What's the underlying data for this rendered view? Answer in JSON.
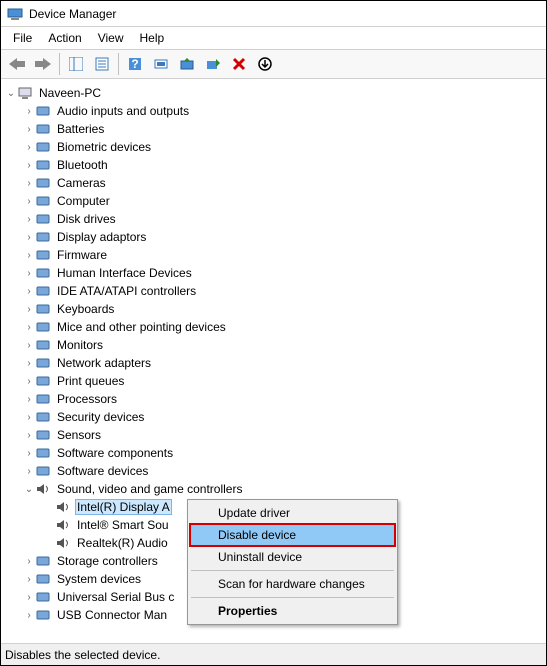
{
  "title": "Device Manager",
  "menus": [
    "File",
    "Action",
    "View",
    "Help"
  ],
  "root": "Naveen-PC",
  "categories": [
    {
      "label": "Audio inputs and outputs",
      "icon": "speaker"
    },
    {
      "label": "Batteries",
      "icon": "battery"
    },
    {
      "label": "Biometric devices",
      "icon": "fingerprint"
    },
    {
      "label": "Bluetooth",
      "icon": "bluetooth"
    },
    {
      "label": "Cameras",
      "icon": "camera"
    },
    {
      "label": "Computer",
      "icon": "computer"
    },
    {
      "label": "Disk drives",
      "icon": "disk"
    },
    {
      "label": "Display adaptors",
      "icon": "display"
    },
    {
      "label": "Firmware",
      "icon": "firmware"
    },
    {
      "label": "Human Interface Devices",
      "icon": "hid"
    },
    {
      "label": "IDE ATA/ATAPI controllers",
      "icon": "ide"
    },
    {
      "label": "Keyboards",
      "icon": "keyboard"
    },
    {
      "label": "Mice and other pointing devices",
      "icon": "mouse"
    },
    {
      "label": "Monitors",
      "icon": "monitor"
    },
    {
      "label": "Network adapters",
      "icon": "network"
    },
    {
      "label": "Print queues",
      "icon": "printer"
    },
    {
      "label": "Processors",
      "icon": "cpu"
    },
    {
      "label": "Security devices",
      "icon": "security"
    },
    {
      "label": "Sensors",
      "icon": "sensor"
    },
    {
      "label": "Software components",
      "icon": "sw"
    },
    {
      "label": "Software devices",
      "icon": "sw"
    }
  ],
  "expanded": {
    "label": "Sound, video and game controllers",
    "children": [
      {
        "label": "Intel(R) Display A",
        "selected": true
      },
      {
        "label": "Intel® Smart Sou"
      },
      {
        "label": "Realtek(R) Audio"
      }
    ]
  },
  "categories_after": [
    {
      "label": "Storage controllers",
      "icon": "storage"
    },
    {
      "label": "System devices",
      "icon": "system"
    },
    {
      "label": "Universal Serial Bus c",
      "icon": "usb"
    },
    {
      "label": "USB Connector Man",
      "icon": "usb"
    }
  ],
  "context_menu": [
    {
      "label": "Update driver"
    },
    {
      "label": "Disable device",
      "hl": true
    },
    {
      "label": "Uninstall device"
    },
    {
      "sep": true
    },
    {
      "label": "Scan for hardware changes"
    },
    {
      "sep": true
    },
    {
      "label": "Properties",
      "bold": true
    }
  ],
  "status": "Disables the selected device."
}
